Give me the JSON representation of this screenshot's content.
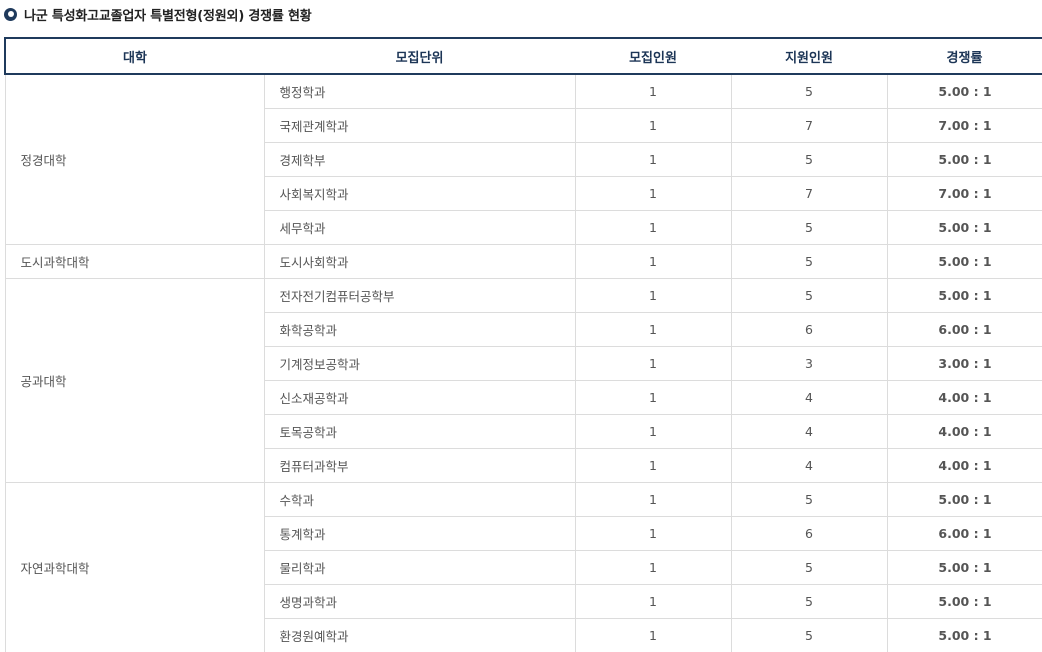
{
  "page": {
    "title": "나군 특성화고교졸업자 특별전형(정원외) 경쟁률 현황"
  },
  "table": {
    "headers": [
      "대학",
      "모집단위",
      "모집인원",
      "지원인원",
      "경쟁률"
    ],
    "groups": [
      {
        "college": "정경대학",
        "rows": [
          {
            "unit": "행정학과",
            "quota": "1",
            "applicants": "5",
            "rate": "5.00 : 1",
            "rate_color": "red"
          },
          {
            "unit": "국제관계학과",
            "quota": "1",
            "applicants": "7",
            "rate": "7.00 : 1",
            "rate_color": "red"
          },
          {
            "unit": "경제학부",
            "quota": "1",
            "applicants": "5",
            "rate": "5.00 : 1",
            "rate_color": "red"
          },
          {
            "unit": "사회복지학과",
            "quota": "1",
            "applicants": "7",
            "rate": "7.00 : 1",
            "rate_color": "red"
          },
          {
            "unit": "세무학과",
            "quota": "1",
            "applicants": "5",
            "rate": "5.00 : 1",
            "rate_color": "red"
          }
        ]
      },
      {
        "college": "도시과학대학",
        "rows": [
          {
            "unit": "도시사회학과",
            "quota": "1",
            "applicants": "5",
            "rate": "5.00 : 1",
            "rate_color": "red"
          }
        ]
      },
      {
        "college": "공과대학",
        "rows": [
          {
            "unit": "전자전기컴퓨터공학부",
            "quota": "1",
            "applicants": "5",
            "rate": "5.00 : 1",
            "rate_color": "red"
          },
          {
            "unit": "화학공학과",
            "quota": "1",
            "applicants": "6",
            "rate": "6.00 : 1",
            "rate_color": "red"
          },
          {
            "unit": "기계정보공학과",
            "quota": "1",
            "applicants": "3",
            "rate": "3.00 : 1",
            "rate_color": "blue"
          },
          {
            "unit": "신소재공학과",
            "quota": "1",
            "applicants": "4",
            "rate": "4.00 : 1",
            "rate_color": "blue"
          },
          {
            "unit": "토목공학과",
            "quota": "1",
            "applicants": "4",
            "rate": "4.00 : 1",
            "rate_color": "blue"
          },
          {
            "unit": "컴퓨터과학부",
            "quota": "1",
            "applicants": "4",
            "rate": "4.00 : 1",
            "rate_color": "blue"
          }
        ]
      },
      {
        "college": "자연과학대학",
        "rows": [
          {
            "unit": "수학과",
            "quota": "1",
            "applicants": "5",
            "rate": "5.00 : 1",
            "rate_color": "red"
          },
          {
            "unit": "통계학과",
            "quota": "1",
            "applicants": "6",
            "rate": "6.00 : 1",
            "rate_color": "red"
          },
          {
            "unit": "물리학과",
            "quota": "1",
            "applicants": "5",
            "rate": "5.00 : 1",
            "rate_color": "red"
          },
          {
            "unit": "생명과학과",
            "quota": "1",
            "applicants": "5",
            "rate": "5.00 : 1",
            "rate_color": "red"
          },
          {
            "unit": "환경원예학과",
            "quota": "1",
            "applicants": "5",
            "rate": "5.00 : 1",
            "rate_color": "red"
          }
        ]
      }
    ]
  },
  "colors": {
    "rate_red": "#e0000e",
    "rate_blue": "#3a44d9",
    "header_border": "#1f3a5c"
  },
  "icons": {
    "title_bullet": "circle-bullet-icon"
  }
}
